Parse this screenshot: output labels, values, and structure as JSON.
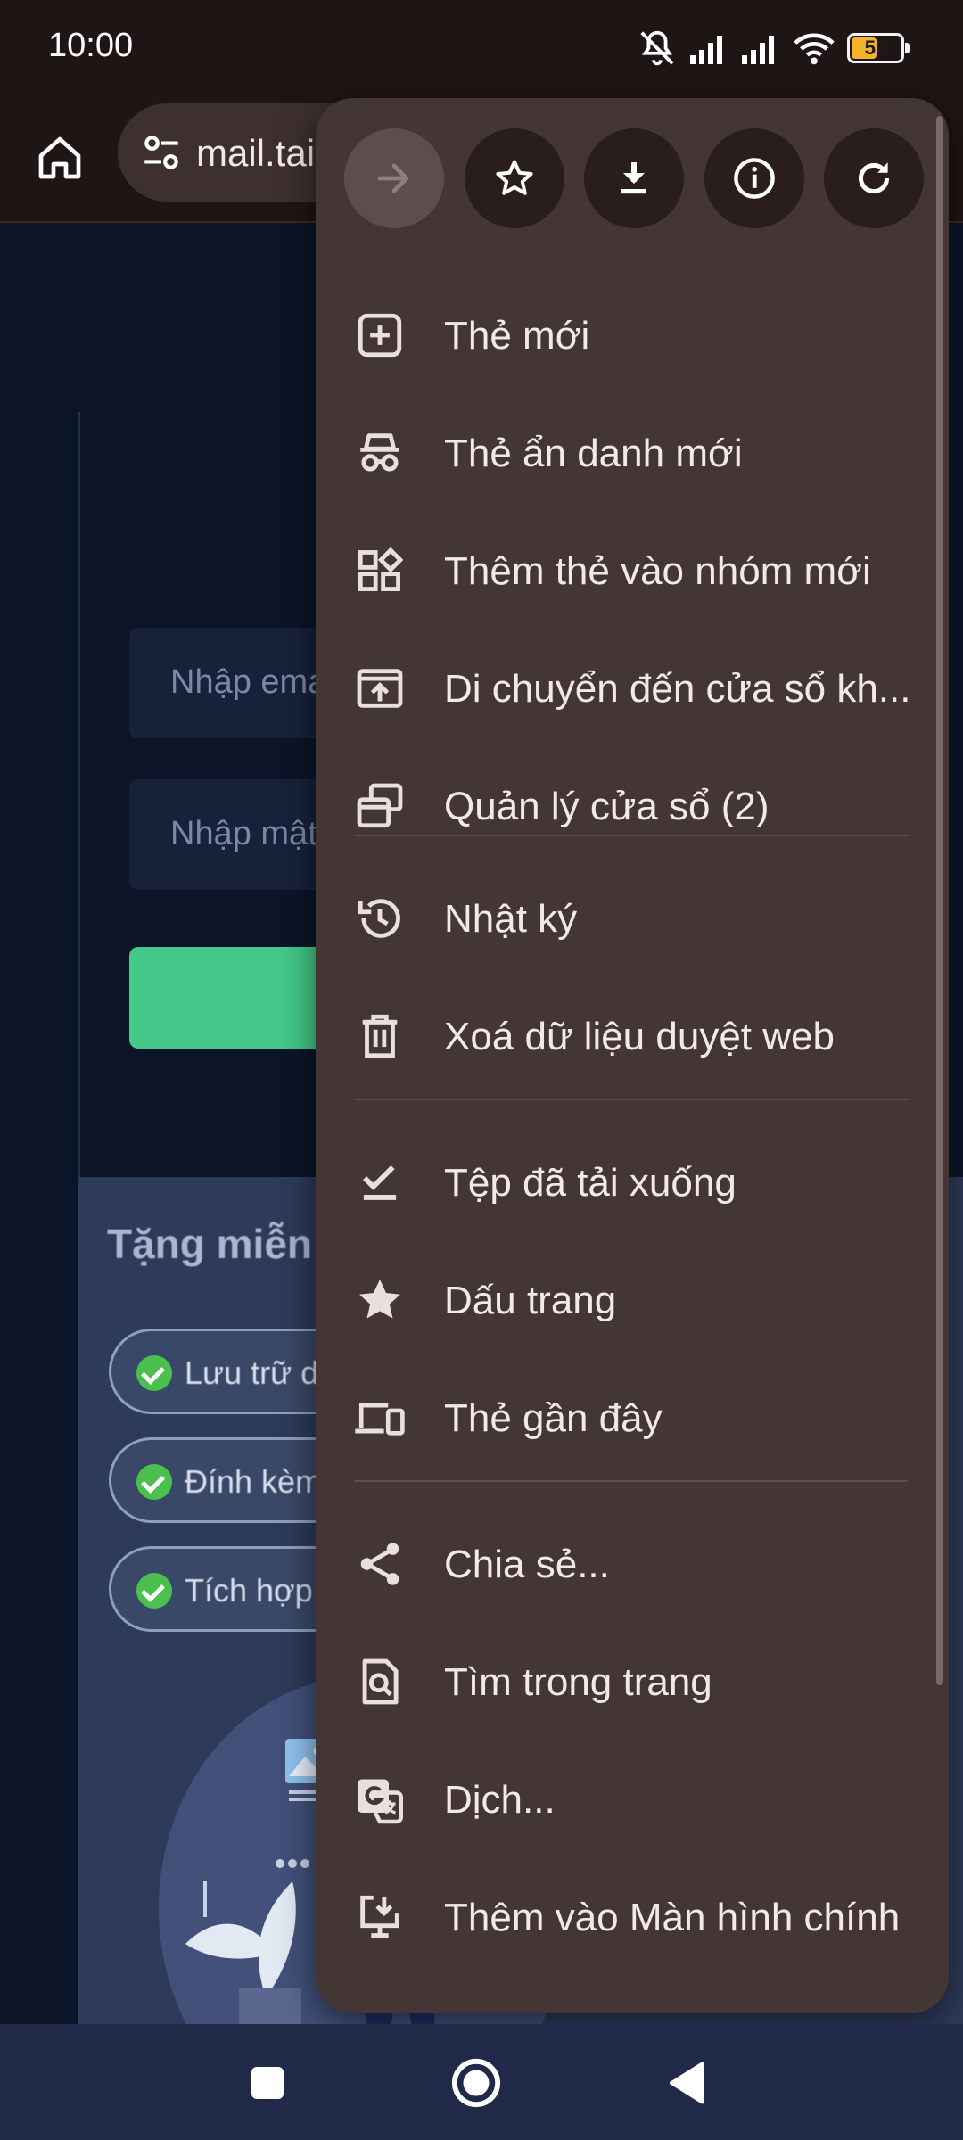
{
  "status_bar": {
    "time": "10:00",
    "battery_percent": "52",
    "battery_level": 0.52,
    "icons": [
      "mute-icon",
      "signal-icon",
      "signal-icon",
      "wifi-icon",
      "battery-icon"
    ]
  },
  "toolbar": {
    "home_icon": "home-icon",
    "url": "mail.tai",
    "settings_icon": "page-info-settings-icon"
  },
  "page": {
    "email_placeholder": "Nhập ema",
    "password_placeholder": "Nhập mật",
    "promo_title": "Tặng miễn",
    "promo_items": [
      "Lưu trữ dữ",
      "Đính kèm",
      "Tích hợp b"
    ]
  },
  "menu": {
    "top_actions": [
      {
        "name": "forward-icon",
        "enabled": false
      },
      {
        "name": "bookmark-star-icon",
        "enabled": true
      },
      {
        "name": "download-icon",
        "enabled": true
      },
      {
        "name": "info-icon",
        "enabled": true
      },
      {
        "name": "refresh-icon",
        "enabled": true
      }
    ],
    "items": [
      {
        "label": "Thẻ mới",
        "icon": "new-tab-icon"
      },
      {
        "label": "Thẻ ẩn danh mới",
        "icon": "incognito-icon"
      },
      {
        "label": "Thêm thẻ vào nhóm mới",
        "icon": "tab-group-icon"
      },
      {
        "label": "Di chuyển đến cửa sổ kh...",
        "icon": "move-window-icon"
      },
      {
        "label": "Quản lý cửa sổ (2)",
        "icon": "manage-windows-icon"
      },
      {
        "label": "Nhật ký",
        "icon": "history-icon"
      },
      {
        "label": "Xoá dữ liệu duyệt web",
        "icon": "trash-icon"
      },
      {
        "label": "Tệp đã tải xuống",
        "icon": "downloads-check-icon"
      },
      {
        "label": "Dấu trang",
        "icon": "bookmarks-star-icon"
      },
      {
        "label": "Thẻ gần đây",
        "icon": "recent-tabs-devices-icon"
      },
      {
        "label": "Chia sẻ...",
        "icon": "share-icon"
      },
      {
        "label": "Tìm trong trang",
        "icon": "find-in-page-icon"
      },
      {
        "label": "Dịch...",
        "icon": "translate-icon"
      },
      {
        "label": "Thêm vào Màn hình chính",
        "icon": "add-to-home-screen-icon"
      }
    ]
  },
  "nav_bar": {
    "buttons": [
      "recents-icon",
      "home-circle-icon",
      "back-triangle-icon"
    ]
  },
  "colors": {
    "menu_bg": "#433634",
    "toolbar_bg": "#1f1514",
    "page_bg": "#0c1528",
    "accent_green": "#44c98a",
    "battery": "#f2b22a"
  }
}
